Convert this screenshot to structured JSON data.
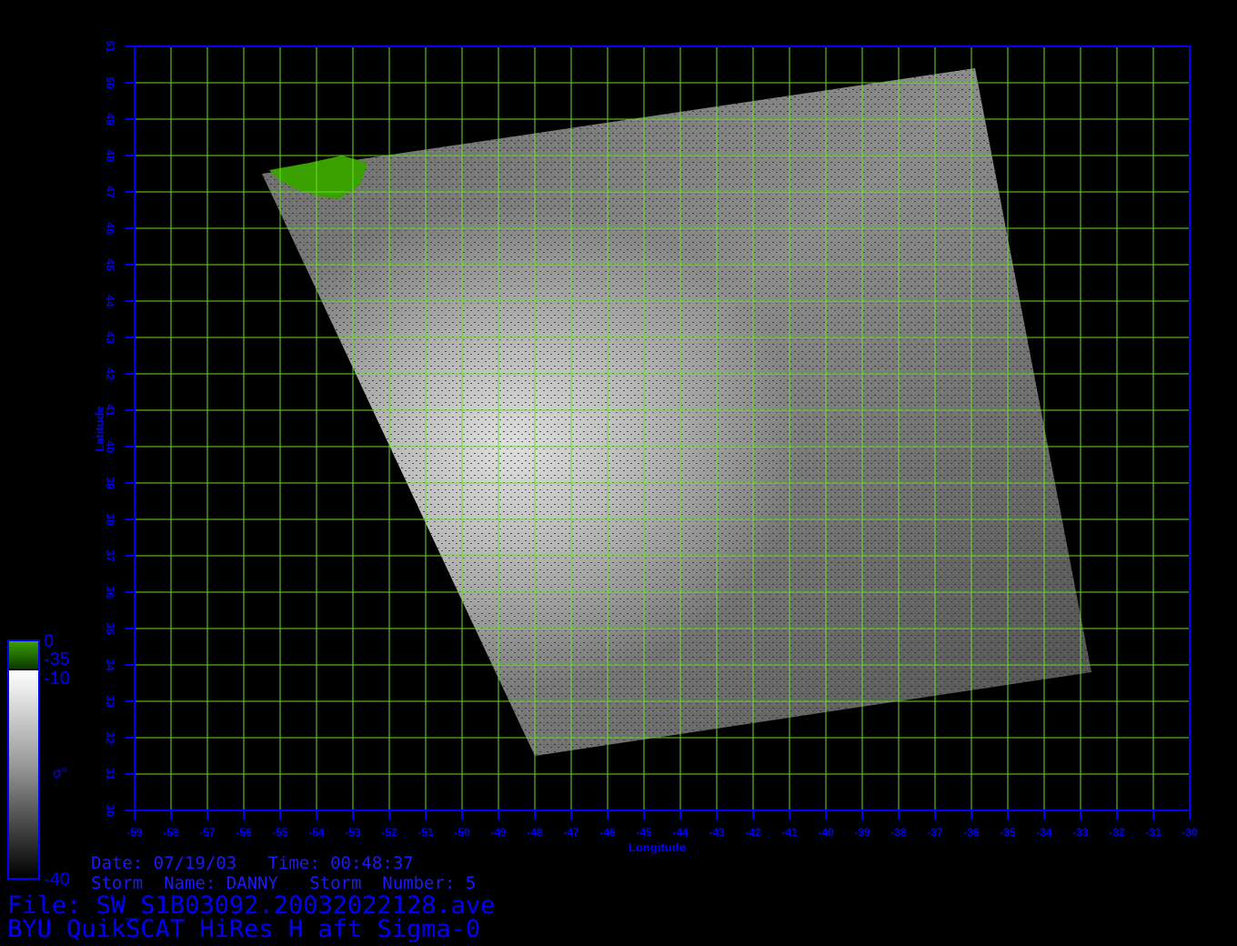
{
  "product": {
    "title": "BYU QuikSCAT HiRes H aft Sigma-0",
    "file": "File: SW_S1B03092.20032022128.ave",
    "date_time": "Date: 07/19/03   Time: 00:48:37",
    "storm": "Storm  Name: DANNY   Storm  Number: 5"
  },
  "axes": {
    "xlabel": "Longitude",
    "ylabel": "Latitude",
    "lon_ticks": [
      -59,
      -58,
      -57,
      -56,
      -55,
      -54,
      -53,
      -52,
      -51,
      -50,
      -49,
      -48,
      -47,
      -46,
      -45,
      -44,
      -43,
      -42,
      -41,
      -40,
      -39,
      -38,
      -37,
      -36,
      -35,
      -34,
      -33,
      -32,
      -31,
      -30
    ],
    "lat_ticks": [
      30,
      31,
      32,
      33,
      34,
      35,
      36,
      37,
      38,
      39,
      40,
      41,
      42,
      43,
      44,
      45,
      46,
      47,
      48,
      49,
      50,
      51
    ],
    "lon_range": [
      -59,
      -30
    ],
    "lat_range": [
      30,
      51
    ]
  },
  "colorbar": {
    "labels": {
      "top": "0",
      "green_low": "-35",
      "gray_high": "-10",
      "bottom": "-40",
      "symbol": "σ°"
    },
    "green_range": [
      -35,
      0
    ],
    "gray_range": [
      -40,
      -10
    ]
  },
  "swath": {
    "corners_lonlat": [
      [
        -55.5,
        47.5
      ],
      [
        -35.9,
        50.4
      ],
      [
        -32.7,
        33.8
      ],
      [
        -48.0,
        31.5
      ]
    ],
    "land_label": "land (green)"
  },
  "colors": {
    "axis": "#0000ff",
    "grid": "#66e01a",
    "land": "#3aa000",
    "background": "#000000"
  }
}
